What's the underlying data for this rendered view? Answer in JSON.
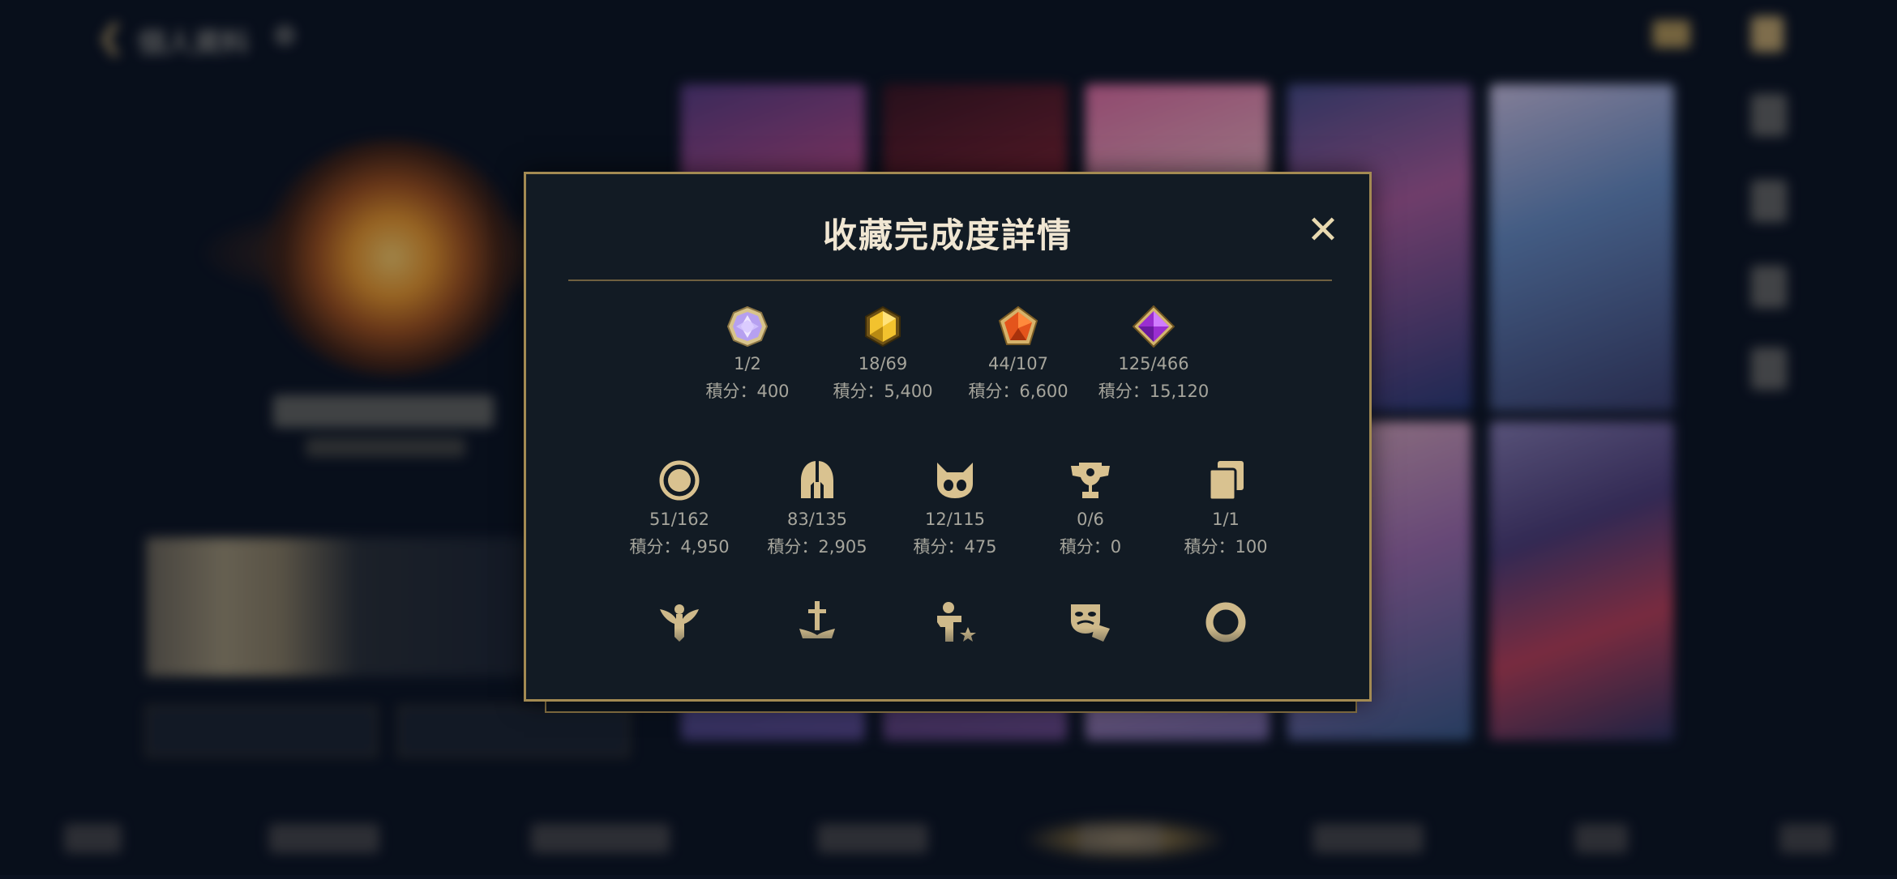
{
  "background": {
    "title": "個人資料",
    "back_icon": "chevron-left-icon",
    "settings_icon": "gear-icon"
  },
  "modal": {
    "title": "收藏完成度詳情",
    "close_label": "✕",
    "rarity_row": [
      {
        "icon": "purple-crystal-gem-icon",
        "value": "1/2",
        "points": "積分：400"
      },
      {
        "icon": "gold-gem-icon",
        "value": "18/69",
        "points": "積分：5,400"
      },
      {
        "icon": "orange-gem-icon",
        "value": "44/107",
        "points": "積分：6,600"
      },
      {
        "icon": "violet-gem-icon",
        "value": "125/466",
        "points": "積分：15,120"
      }
    ],
    "category_row": [
      {
        "icon": "ring-icon",
        "value": "51/162",
        "points": "積分：4,950"
      },
      {
        "icon": "helmet-icon",
        "value": "83/135",
        "points": "積分：2,905"
      },
      {
        "icon": "poro-icon",
        "value": "12/115",
        "points": "積分：475"
      },
      {
        "icon": "trophy-icon",
        "value": "0/6",
        "points": "積分：0"
      },
      {
        "icon": "cards-icon",
        "value": "1/1",
        "points": "積分：100"
      }
    ],
    "third_row_icons": [
      "winged-emblem-icon",
      "sword-emblem-icon",
      "player-star-icon",
      "masks-icon",
      "circle-ring-icon"
    ]
  },
  "colors": {
    "gold": "#c8aa6e",
    "modal_bg": "#121b24",
    "border": "#a38a52",
    "text_muted": "#a6a59c",
    "title": "#f0e6d2"
  }
}
